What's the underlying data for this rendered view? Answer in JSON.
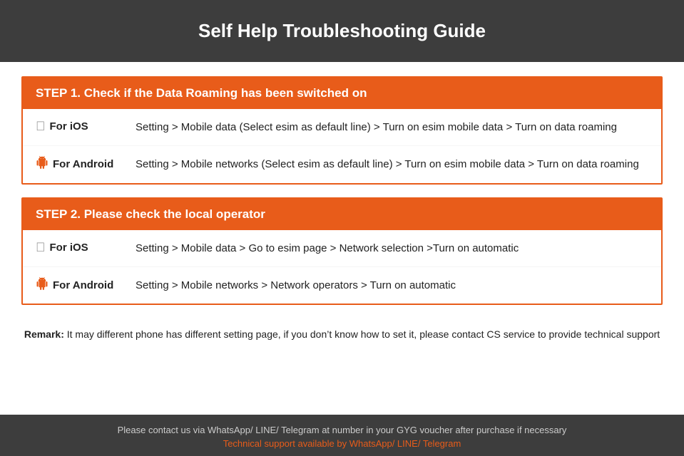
{
  "header": {
    "title": "Self Help Troubleshooting Guide"
  },
  "step1": {
    "header": "STEP 1.  Check if the Data Roaming has been switched on",
    "ios_label": "For iOS",
    "ios_instruction": "Setting > Mobile data (Select esim as default line) > Turn on esim mobile data > Turn on data roaming",
    "android_label": "For Android",
    "android_instruction": "Setting > Mobile networks (Select esim as default line) > Turn on esim mobile data > Turn on data roaming"
  },
  "step2": {
    "header": "STEP 2.  Please check the local operator",
    "ios_label": "For iOS",
    "ios_instruction": "Setting > Mobile data > Go to esim page > Network selection >Turn on automatic",
    "android_label": "For Android",
    "android_instruction": "Setting > Mobile networks > Network operators > Turn on automatic"
  },
  "remark": {
    "label": "Remark:",
    "text": " It may different phone has different setting page, if you don’t know how to set it,  please contact CS service to provide technical support"
  },
  "footer": {
    "contact_text": "Please contact us via WhatsApp/ LINE/ Telegram at number in your GYG voucher after purchase if necessary",
    "support_text": "Technical support available by WhatsApp/ LINE/ Telegram"
  },
  "icons": {
    "ios": "",
    "android": "🤖"
  }
}
